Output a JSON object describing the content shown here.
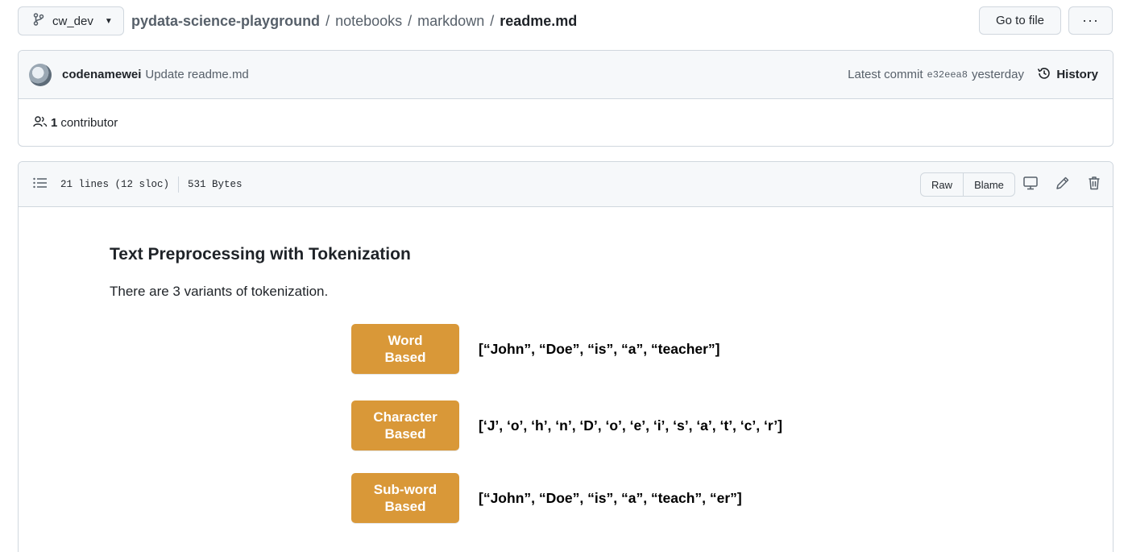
{
  "branch": {
    "name": "cw_dev"
  },
  "breadcrumb": {
    "repo": "pydata-science-playground",
    "sep": "/",
    "folders": [
      "notebooks",
      "markdown"
    ],
    "file": "readme.md"
  },
  "toolbar": {
    "go_to_file": "Go to file",
    "more": "···"
  },
  "commit": {
    "author": "codenamewei",
    "message": "Update readme.md",
    "latest_label": "Latest commit",
    "sha": "e32eea8",
    "time": "yesterday",
    "history_label": "History"
  },
  "contributors": {
    "count": "1",
    "label": "contributor"
  },
  "file_header": {
    "lines": "21 lines (12 sloc)",
    "size": "531 Bytes",
    "raw_label": "Raw",
    "blame_label": "Blame"
  },
  "markdown": {
    "title": "Text Preprocessing with Tokenization",
    "paragraph": "There are 3 variants of tokenization.",
    "variants": [
      {
        "line1": "Word",
        "line2": "Based",
        "result": "[“John”, “Doe”, “is”, “a”, “teacher”]"
      },
      {
        "line1": "Character",
        "line2": "Based",
        "result": "[‘J’, ‘o’, ‘h’, ‘n’, ‘D’, ‘o’, ‘e’, ‘i’, ‘s’, ‘a’, ‘t’, ‘c’, ‘r’]"
      },
      {
        "line1": "Sub-word",
        "line2": "Based",
        "result": "[“John”, “Doe”, “is”, “a”, “teach”, “er”]"
      }
    ]
  },
  "colors": {
    "token_box": "#d99838",
    "border": "#d0d7de",
    "header_bg": "#f6f8fa"
  },
  "icons": [
    "git-branch-icon",
    "caret-down-icon",
    "history-icon",
    "people-icon",
    "list-icon",
    "desktop-icon",
    "pencil-icon",
    "trash-icon"
  ]
}
